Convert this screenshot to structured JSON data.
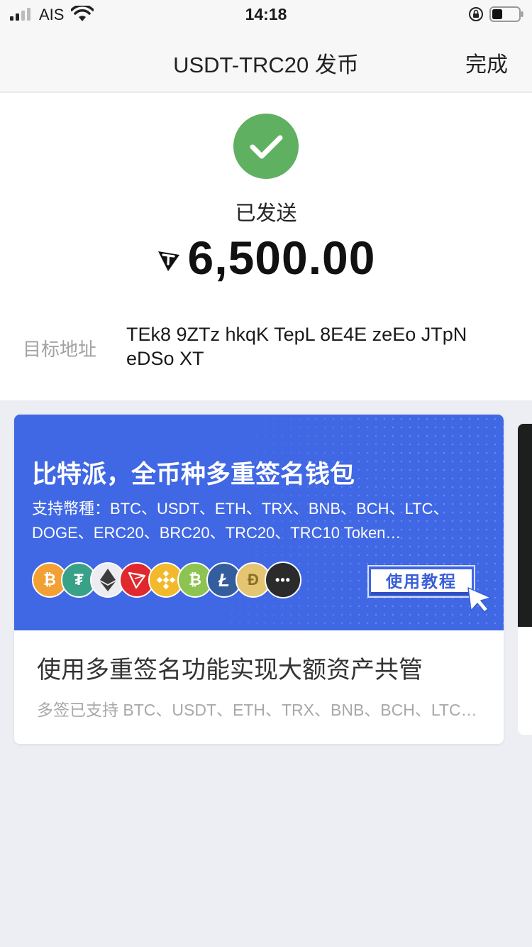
{
  "status_bar": {
    "carrier": "AIS",
    "time": "14:18"
  },
  "nav": {
    "title": "USDT-TRC20 发币",
    "done_label": "完成"
  },
  "result": {
    "status_text": "已发送",
    "amount": "6,500.00",
    "token_icon": "tron-icon",
    "address_label": "目标地址",
    "address_value": "TEk8 9ZTz hkqK TepL 8E4E zeEo JTpN eDSo XT"
  },
  "promo": {
    "banner_title": "比特派，全币种多重签名钱包",
    "banner_subtitle": "支持幣種：BTC、USDT、ETH、TRX、BNB、BCH、LTC、DOGE、ERC20、BRC20、TRC20、TRC10 Token…",
    "tutorial_label": "使用教程",
    "coins": [
      {
        "icon": "bitcoin-icon",
        "glyph": "₿",
        "color": "#f2a034"
      },
      {
        "icon": "tether-icon",
        "glyph": "₮",
        "color": "#3aa189"
      },
      {
        "icon": "ethereum-icon",
        "glyph": "◆",
        "color": "#e9e9ee"
      },
      {
        "icon": "tron-icon",
        "glyph": "▽",
        "color": "#e0282e"
      },
      {
        "icon": "bnb-icon",
        "glyph": "◈",
        "color": "#f1b92b"
      },
      {
        "icon": "bitcoin-cash-icon",
        "glyph": "₿",
        "color": "#8dc351"
      },
      {
        "icon": "litecoin-icon",
        "glyph": "Ł",
        "color": "#345d9d"
      },
      {
        "icon": "dogecoin-icon",
        "glyph": "Ð",
        "color": "#e0c36f"
      },
      {
        "icon": "more-icon",
        "glyph": "•••",
        "color": "#2b2b2b"
      }
    ],
    "title": "使用多重签名功能实现大额资产共管",
    "description": "多签已支持 BTC、USDT、ETH、TRX、BNB、BCH、LTC、DOGE"
  },
  "colors": {
    "success": "#5fb061",
    "banner_blue": "#4067e4",
    "page_bg": "#eceef3"
  }
}
